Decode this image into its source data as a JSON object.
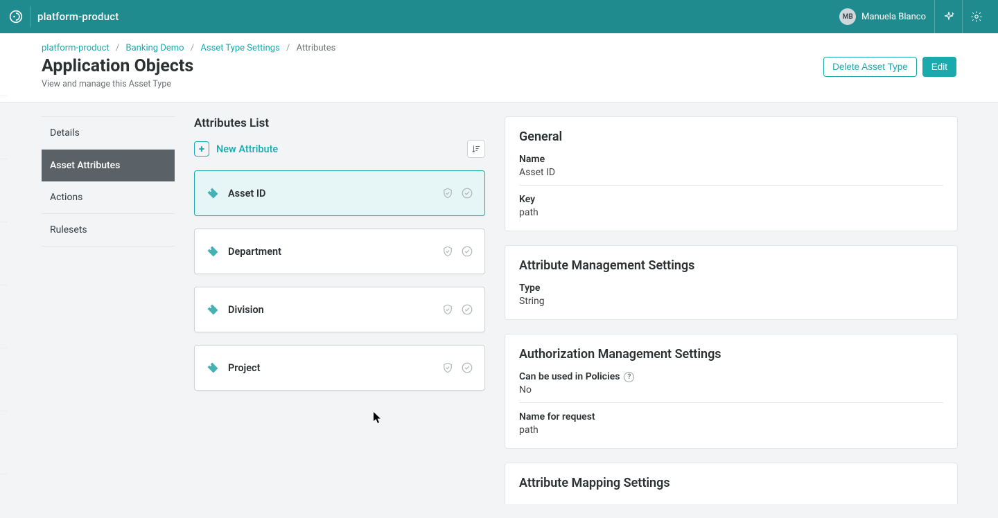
{
  "topbar": {
    "product": "platform-product",
    "user_initials": "MB",
    "user_name": "Manuela Blanco"
  },
  "breadcrumbs": [
    {
      "label": "platform-product",
      "link": true
    },
    {
      "label": "Banking Demo",
      "link": true
    },
    {
      "label": "Asset Type Settings",
      "link": true
    },
    {
      "label": "Attributes",
      "link": false
    }
  ],
  "page": {
    "title": "Application Objects",
    "subtitle": "View and manage this Asset Type",
    "delete_btn": "Delete Asset Type",
    "edit_btn": "Edit"
  },
  "leftnav": [
    {
      "label": "Details",
      "active": false
    },
    {
      "label": "Asset Attributes",
      "active": true
    },
    {
      "label": "Actions",
      "active": false
    },
    {
      "label": "Rulesets",
      "active": false
    }
  ],
  "attributes": {
    "section_title": "Attributes List",
    "new_label": "New Attribute",
    "items": [
      {
        "name": "Asset ID",
        "selected": true
      },
      {
        "name": "Department",
        "selected": false
      },
      {
        "name": "Division",
        "selected": false
      },
      {
        "name": "Project",
        "selected": false
      }
    ]
  },
  "right": {
    "general": {
      "title": "General",
      "name_label": "Name",
      "name_value": "Asset ID",
      "key_label": "Key",
      "key_value": "path"
    },
    "mgmt": {
      "title": "Attribute Management Settings",
      "type_label": "Type",
      "type_value": "String"
    },
    "authz": {
      "title": "Authorization Management Settings",
      "pol_label": "Can be used in Policies",
      "pol_value": "No",
      "req_label": "Name for request",
      "req_value": "path"
    },
    "mapping": {
      "title": "Attribute Mapping Settings"
    }
  }
}
